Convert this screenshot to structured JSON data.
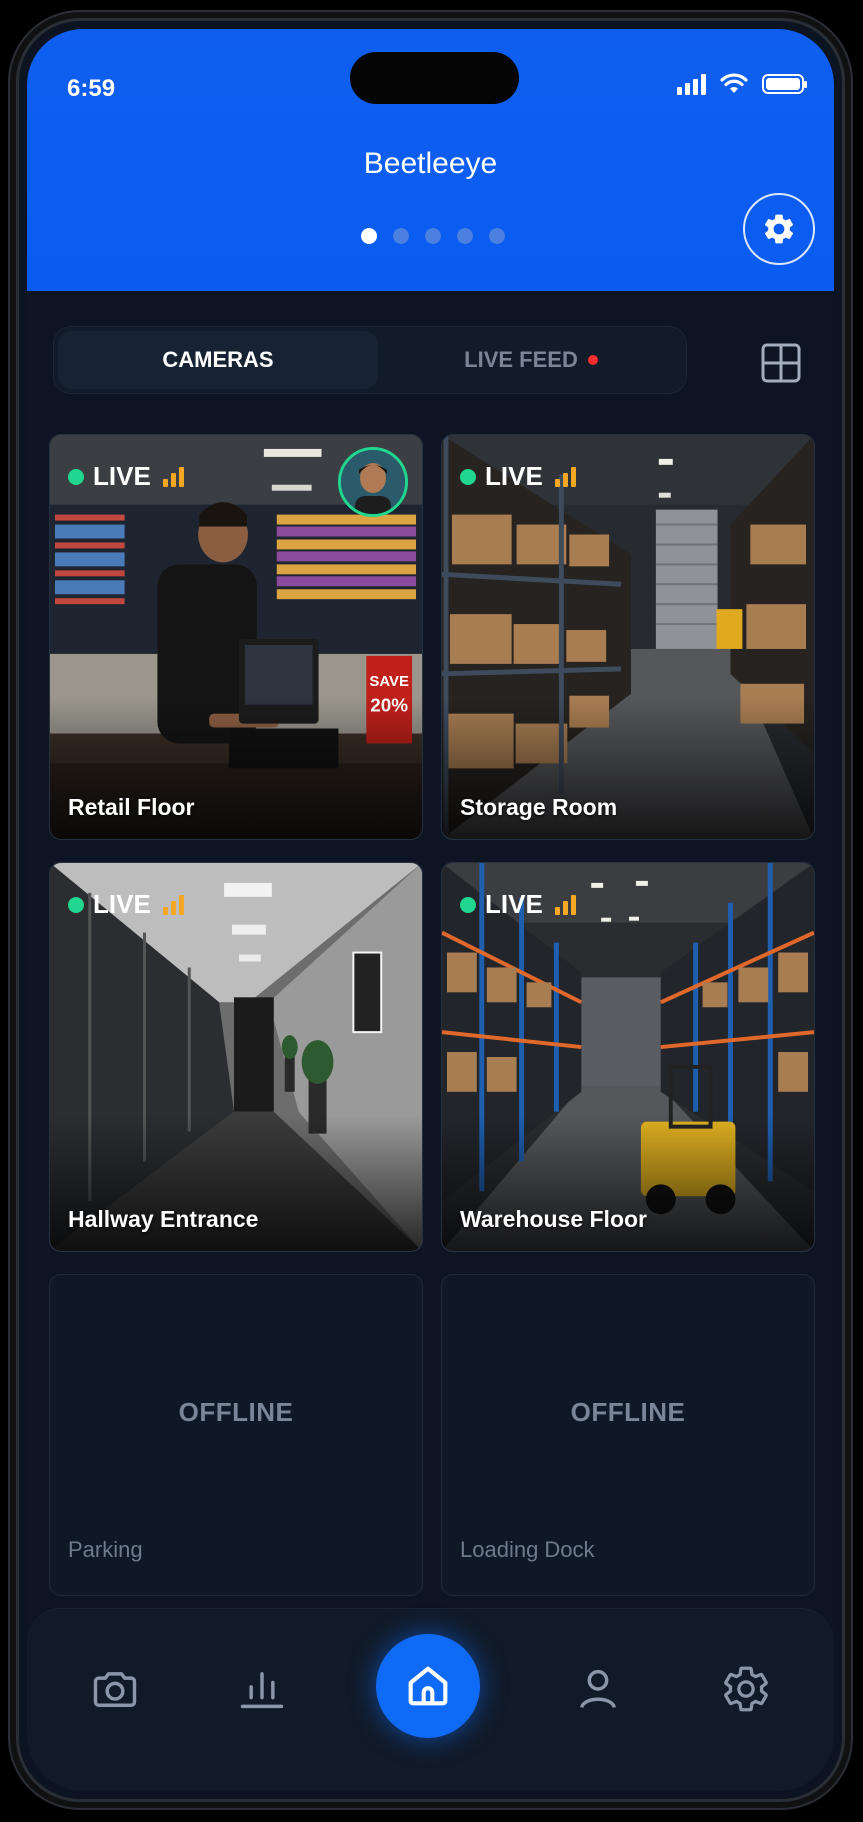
{
  "status_bar": {
    "time": "6:59"
  },
  "header": {
    "title": "Beetleeye",
    "page_count": 5,
    "active_page": 1
  },
  "tabs": [
    {
      "label": "CAMERAS",
      "active": true
    },
    {
      "label": "LIVE FEED",
      "active": false,
      "indicator_color": "#ff2d2d"
    }
  ],
  "cameras": [
    {
      "name": "Retail Floor",
      "status": "LIVE",
      "has_avatar": true
    },
    {
      "name": "Storage Room",
      "status": "LIVE"
    },
    {
      "name": "Hallway Entrance",
      "status": "LIVE"
    },
    {
      "name": "Warehouse Floor",
      "status": "LIVE"
    },
    {
      "name": "Parking",
      "status": "OFFLINE"
    },
    {
      "name": "Loading Dock",
      "status": "OFFLINE"
    }
  ],
  "bottom_nav": [
    {
      "icon": "camera-icon"
    },
    {
      "icon": "chart-icon"
    },
    {
      "icon": "home-icon",
      "active": true
    },
    {
      "icon": "user-icon"
    },
    {
      "icon": "gear-icon"
    }
  ],
  "colors": {
    "accent": "#0f6af5",
    "header": "#0a5cf0",
    "live": "#21d68f",
    "signal": "#f5a623",
    "background": "#0d1522"
  }
}
